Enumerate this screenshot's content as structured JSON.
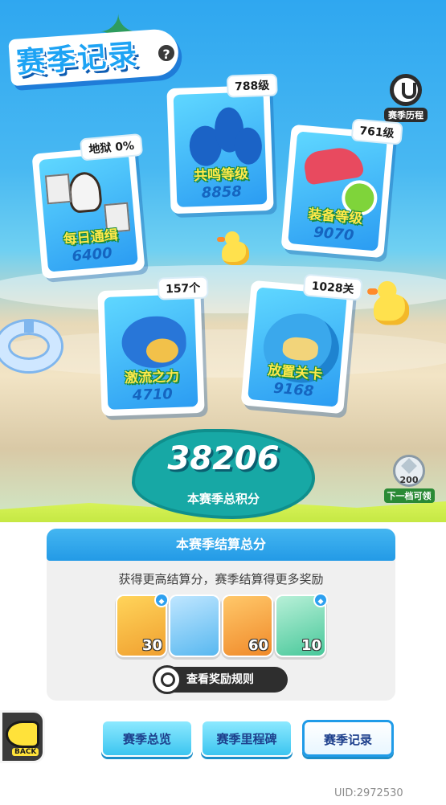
{
  "header": {
    "title": "赛季记录",
    "help_icon": "?",
    "journey_label": "赛季历程"
  },
  "cards": [
    {
      "id": "daily",
      "name": "每日通缉",
      "score": "6400",
      "tag": "地狱 0%"
    },
    {
      "id": "resonance",
      "name": "共鸣等级",
      "score": "8858",
      "tag": "788级"
    },
    {
      "id": "equipment",
      "name": "装备等级",
      "score": "9070",
      "tag": "761级"
    },
    {
      "id": "torrent",
      "name": "激流之力",
      "score": "4710",
      "tag": "157个"
    },
    {
      "id": "idle",
      "name": "放置关卡",
      "score": "9168",
      "tag": "1028关"
    }
  ],
  "total": {
    "score": "38206",
    "label": "本赛季总积分"
  },
  "next_reward": {
    "value": "200",
    "label": "下一档可领"
  },
  "settlement": {
    "title": "本赛季结算总分",
    "description": "获得更高结算分，赛季结算得更多奖励",
    "rewards": [
      {
        "count": "30",
        "color": "#f0a030"
      },
      {
        "count": "",
        "color": "#58b8f0"
      },
      {
        "count": "60",
        "color": "#f08a2a"
      },
      {
        "count": "10",
        "color": "#48c89a"
      }
    ],
    "rule_button": "查看奖励规则"
  },
  "nav": {
    "back_label": "BACK",
    "tabs": [
      "赛季总览",
      "赛季里程碑",
      "赛季记录"
    ],
    "active_tab": "赛季记录"
  },
  "uid": "UID:2972530",
  "colors": {
    "sky": "#2fa7f0",
    "accent_blue": "#239ae6",
    "score_blue": "#1565c0",
    "splash_teal": "#17a8a5",
    "name_yellow": "#ffe94a"
  }
}
